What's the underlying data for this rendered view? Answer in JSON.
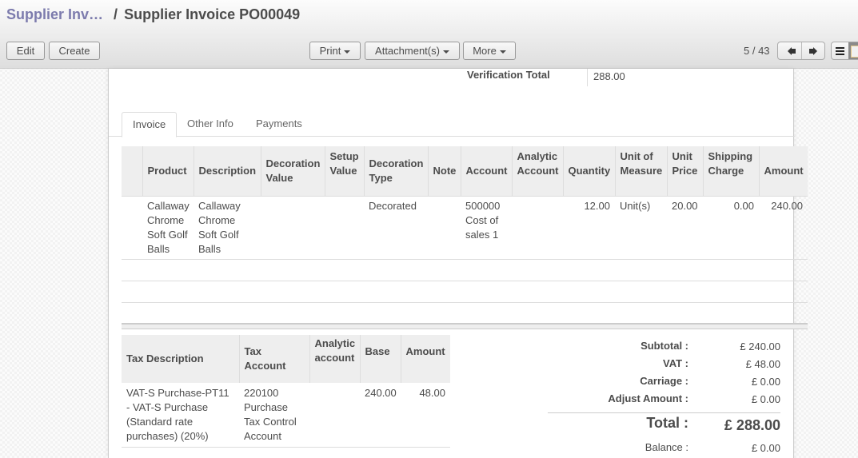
{
  "breadcrumb": {
    "parent": "Supplier Inv…",
    "separator": "/",
    "current": "Supplier Invoice PO00049"
  },
  "toolbar": {
    "edit_label": "Edit",
    "create_label": "Create",
    "print_label": "Print",
    "attachments_label": "Attachment(s)",
    "more_label": "More"
  },
  "pager": {
    "value": "5 / 43",
    "prev_icon": "arrow-left-icon",
    "next_icon": "arrow-right-icon"
  },
  "view_switcher": {
    "list_icon": "list-view-icon",
    "form_icon": "form-view-icon",
    "active": "form"
  },
  "header_fields": {
    "verification_total_label": "Verification Total",
    "verification_total_value": "288.00"
  },
  "tabs": [
    {
      "label": "Invoice",
      "active": true
    },
    {
      "label": "Other Info",
      "active": false
    },
    {
      "label": "Payments",
      "active": false
    }
  ],
  "invoice_lines": {
    "columns": [
      "",
      "Product",
      "Description",
      "Decoration Value",
      "Setup Value",
      "Decoration Type",
      "Note",
      "Account",
      "Analytic Account",
      "Quantity",
      "Unit of Measure",
      "Unit Price",
      "Shipping Charge",
      "Amount"
    ],
    "rows": [
      {
        "product": "Callaway Chrome Soft Golf Balls",
        "description": "Callaway Chrome Soft Golf Balls",
        "decoration_value": "",
        "setup_value": "",
        "decoration_type": "Decorated",
        "note": "",
        "account": "500000 Cost of sales 1",
        "analytic_account": "",
        "quantity": "12.00",
        "unit_of_measure": "Unit(s)",
        "unit_price": "20.00",
        "shipping_charge": "0.00",
        "amount": "240.00"
      }
    ]
  },
  "tax_lines": {
    "columns": [
      "Tax Description",
      "Tax Account",
      "Analytic account",
      "Base",
      "Amount"
    ],
    "rows": [
      {
        "tax_description": "VAT-S Purchase-PT11 - VAT-S Purchase (Standard rate purchases) (20%)",
        "tax_account": "220100 Purchase Tax Control Account",
        "analytic_account": "",
        "base": "240.00",
        "amount": "48.00"
      }
    ]
  },
  "totals": {
    "subtotal_label": "Subtotal :",
    "subtotal_value": "£ 240.00",
    "vat_label": "VAT :",
    "vat_value": "£ 48.00",
    "carriage_label": "Carriage :",
    "carriage_value": "£ 0.00",
    "adjust_label": "Adjust Amount :",
    "adjust_value": "£ 0.00",
    "total_label": "Total :",
    "total_value": "£ 288.00",
    "balance_label": "Balance :",
    "balance_value": "£ 0.00"
  }
}
